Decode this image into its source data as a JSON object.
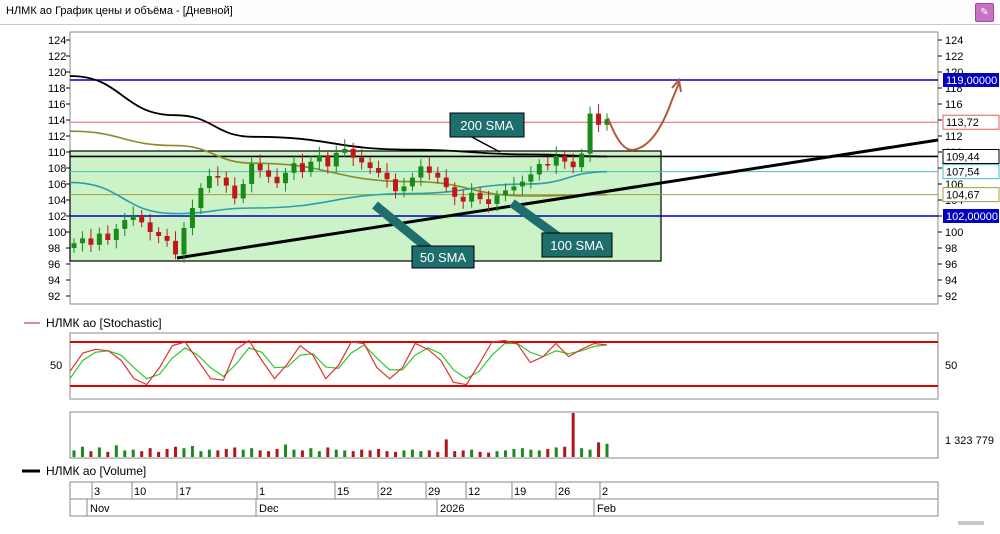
{
  "window": {
    "title": "НЛМК ао График цены и объёма - [Дневной]",
    "button_icon": "pin-icon"
  },
  "price_panel": {
    "y_ticks": [
      "124",
      "122",
      "120",
      "118",
      "116",
      "114",
      "112",
      "110",
      "108",
      "106",
      "104",
      "102",
      "100",
      "98",
      "96",
      "94",
      "92"
    ],
    "ylim": [
      91,
      125.5
    ],
    "levels": [
      {
        "name": "resistance",
        "value": 119,
        "label": "119,00000",
        "color": "#0000c0"
      },
      {
        "name": "support",
        "value": 102,
        "label": "102,00000",
        "color": "#0000c0"
      },
      {
        "name": "last-price",
        "value": 113.72,
        "label": "113,72",
        "color": "#e06060"
      },
      {
        "name": "sma-200",
        "value": 109.44,
        "label": "109,44",
        "color": "#000000"
      },
      {
        "name": "sma-50",
        "value": 107.54,
        "label": "107,54",
        "color": "#40c0c0"
      },
      {
        "name": "sma-100",
        "value": 104.67,
        "label": "104,67",
        "color": "#a0a040"
      }
    ],
    "annotations": [
      "200 SMA",
      "50 SMA",
      "100 SMA"
    ]
  },
  "stochastic_panel": {
    "legend": "НЛМК ао [Stochastic]",
    "y_tick": "50",
    "upper_line": 80,
    "lower_line": 20
  },
  "volume_panel": {
    "legend": "НЛМК ао [Volume]",
    "last_value": "1 323 779"
  },
  "time_axis": {
    "days": [
      "3",
      "10",
      "17",
      "1",
      "15",
      "22",
      "29",
      "12",
      "19",
      "26",
      "2"
    ],
    "months": [
      "Nov",
      "Dec",
      "2026",
      "Feb"
    ]
  },
  "chart_data": {
    "type": "candlestick",
    "x_type": "date",
    "dates": [
      "2025-10-30",
      "2025-10-31",
      "2025-11-03",
      "2025-11-04",
      "2025-11-05",
      "2025-11-06",
      "2025-11-07",
      "2025-11-10",
      "2025-11-11",
      "2025-11-12",
      "2025-11-13",
      "2025-11-14",
      "2025-11-17",
      "2025-11-18",
      "2025-11-19",
      "2025-11-20",
      "2025-11-21",
      "2025-11-24",
      "2025-11-25",
      "2025-11-26",
      "2025-11-27",
      "2025-11-28",
      "2025-12-01",
      "2025-12-02",
      "2025-12-03",
      "2025-12-04",
      "2025-12-05",
      "2025-12-08",
      "2025-12-09",
      "2025-12-10",
      "2025-12-11",
      "2025-12-12",
      "2025-12-15",
      "2025-12-16",
      "2025-12-17",
      "2025-12-18",
      "2025-12-19",
      "2025-12-22",
      "2025-12-23",
      "2025-12-24",
      "2025-12-25",
      "2025-12-26",
      "2025-12-29",
      "2025-12-30",
      "2026-01-05",
      "2026-01-06",
      "2026-01-08",
      "2026-01-09",
      "2026-01-12",
      "2026-01-13",
      "2026-01-14",
      "2026-01-15",
      "2026-01-16",
      "2026-01-19",
      "2026-01-20",
      "2026-01-21",
      "2026-01-22",
      "2026-01-23",
      "2026-01-26",
      "2026-01-27",
      "2026-01-28",
      "2026-01-29",
      "2026-01-30",
      "2026-02-02"
    ],
    "close": [
      98.6,
      99.2,
      98.4,
      99.8,
      99.0,
      100.4,
      101.5,
      102.0,
      101.2,
      100.0,
      99.5,
      98.9,
      97.2,
      100.5,
      103.0,
      105.5,
      107.0,
      106.8,
      105.8,
      104.2,
      106.0,
      108.5,
      107.7,
      106.9,
      106.1,
      107.4,
      108.6,
      107.5,
      108.8,
      109.6,
      108.2,
      109.9,
      110.4,
      109.3,
      108.7,
      108.0,
      107.4,
      106.6,
      105.1,
      105.7,
      106.8,
      108.2,
      107.4,
      106.8,
      105.6,
      104.4,
      103.8,
      104.9,
      104.1,
      103.5,
      104.6,
      105.2,
      105.7,
      106.3,
      107.2,
      108.5,
      108.3,
      109.5,
      108.8,
      108.1,
      109.8,
      114.8,
      113.4,
      114.1
    ],
    "sma_200": {
      "x": [
        "2025-10-30",
        "2025-11-17",
        "2025-12-01",
        "2025-12-29",
        "2026-01-19",
        "2026-02-02"
      ],
      "values": [
        119.5,
        114.6,
        111.9,
        110.3,
        109.7,
        109.44
      ]
    },
    "sma_100": {
      "x": [
        "2025-10-30",
        "2025-11-17",
        "2025-12-01",
        "2025-12-29",
        "2026-01-19",
        "2026-02-02"
      ],
      "values": [
        112.6,
        110.8,
        108.6,
        106.3,
        104.5,
        104.67
      ]
    },
    "sma_50": {
      "x": [
        "2025-10-30",
        "2025-11-17",
        "2025-12-01",
        "2025-12-29",
        "2026-01-19",
        "2026-02-02"
      ],
      "values": [
        106.2,
        102.3,
        103.0,
        104.8,
        106.0,
        107.54
      ]
    },
    "stochastic_k": [
      40,
      65,
      70,
      68,
      55,
      30,
      22,
      45,
      75,
      80,
      55,
      30,
      28,
      70,
      82,
      55,
      30,
      50,
      75,
      62,
      30,
      48,
      80,
      78,
      45,
      30,
      45,
      78,
      70,
      55,
      25,
      22,
      50,
      80,
      82,
      77,
      52,
      60,
      78,
      60,
      70,
      78,
      76
    ],
    "stochastic_d": [
      30,
      55,
      66,
      68,
      62,
      45,
      30,
      36,
      58,
      72,
      62,
      45,
      33,
      50,
      72,
      66,
      45,
      46,
      62,
      64,
      46,
      44,
      65,
      76,
      58,
      42,
      42,
      62,
      72,
      64,
      42,
      30,
      40,
      62,
      78,
      78,
      66,
      60,
      68,
      64,
      68,
      74,
      76
    ],
    "volume": [
      9,
      14,
      8,
      13,
      7,
      16,
      9,
      10,
      8,
      12,
      7,
      11,
      14,
      12,
      15,
      8,
      10,
      9,
      11,
      13,
      10,
      12,
      9,
      8,
      11,
      17,
      10,
      9,
      12,
      8,
      13,
      10,
      9,
      8,
      10,
      9,
      11,
      8,
      7,
      9,
      10,
      8,
      9,
      7,
      24,
      8,
      9,
      10,
      7,
      6,
      8,
      9,
      11,
      12,
      10,
      9,
      11,
      13,
      14,
      60,
      12,
      10,
      20,
      18
    ]
  }
}
